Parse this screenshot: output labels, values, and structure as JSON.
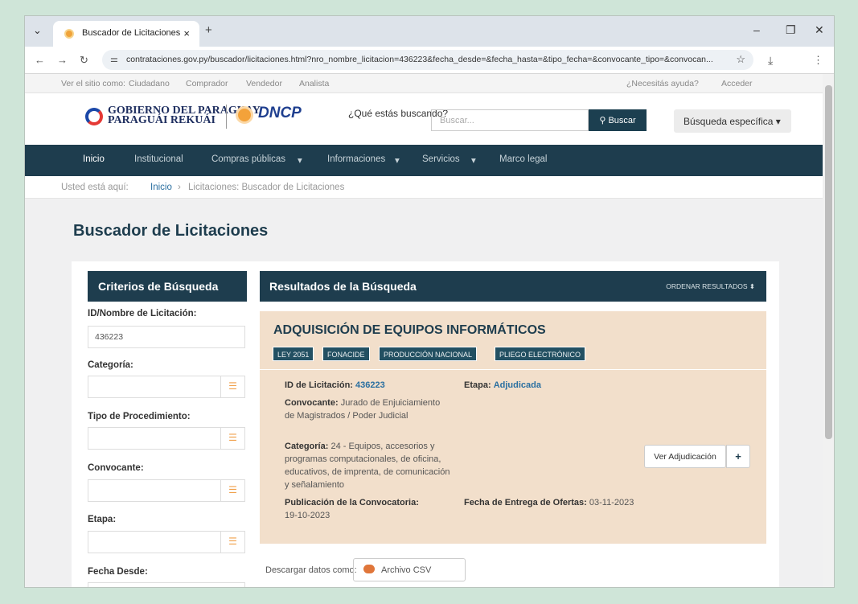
{
  "browser": {
    "tab_title": "Buscador de Licitaciones",
    "url": "contrataciones.gov.py/buscador/licitaciones.html?nro_nombre_licitacion=436223&fecha_desde=&fecha_hasta=&tipo_fecha=&convocante_tipo=&convocan..."
  },
  "utility": {
    "view_as": "Ver el sitio como:",
    "roles": [
      "Ciudadano",
      "Comprador",
      "Vendedor",
      "Analista"
    ],
    "help": "¿Necesitás ayuda?",
    "login": "Acceder"
  },
  "header": {
    "gov_line1": "GOBIERNO DEL PARAGUAY",
    "gov_line2": "PARAGUÁI REKUÁI",
    "agency": "DNCP",
    "question": "¿Qué estás buscando?",
    "search_placeholder": "Buscar...",
    "search_button": "Buscar",
    "specific_search": "Búsqueda específica"
  },
  "nav": {
    "items": [
      "Inicio",
      "Institucional",
      "Compras públicas",
      "Informaciones",
      "Servicios",
      "Marco legal"
    ]
  },
  "breadcrumb": {
    "prefix": "Usted está aquí:",
    "home": "Inicio",
    "current": "Licitaciones: Buscador de Licitaciones"
  },
  "page_title": "Buscador de Licitaciones",
  "criteria": {
    "header": "Criterios de Búsqueda",
    "id_label": "ID/Nombre de Licitación:",
    "id_value": "436223",
    "categoria_label": "Categoría:",
    "tipo_label": "Tipo de Procedimiento:",
    "convocante_label": "Convocante:",
    "etapa_label": "Etapa:",
    "fecha_desde_label": "Fecha Desde:"
  },
  "results": {
    "header": "Resultados de la Búsqueda",
    "sort": "ORDENAR RESULTADOS",
    "title": "ADQUISICIÓN DE EQUIPOS INFORMÁTICOS",
    "tags": [
      "LEY 2051",
      "FONACIDE",
      "PRODUCCIÓN NACIONAL",
      "PLIEGO ELECTRÓNICO"
    ],
    "id_label": "ID de Licitación:",
    "id_value": "436223",
    "etapa_label": "Etapa:",
    "etapa_value": "Adjudicada",
    "convocante_label": "Convocante:",
    "convocante_value": "Jurado de Enjuiciamiento de Magistrados / Poder Judicial",
    "categoria_label": "Categoría:",
    "categoria_value": "24 - Equipos, accesorios y programas computacionales, de oficina, educativos, de imprenta, de comunicación y señalamiento",
    "publicacion_label": "Publicación de la Convocatoria:",
    "publicacion_value": "19-10-2023",
    "entrega_label": "Fecha de Entrega de Ofertas:",
    "entrega_value": "03-11-2023",
    "ver_button": "Ver Adjudicación",
    "plus_button": "+"
  },
  "download": {
    "label": "Descargar datos como:",
    "csv": "Archivo CSV"
  }
}
